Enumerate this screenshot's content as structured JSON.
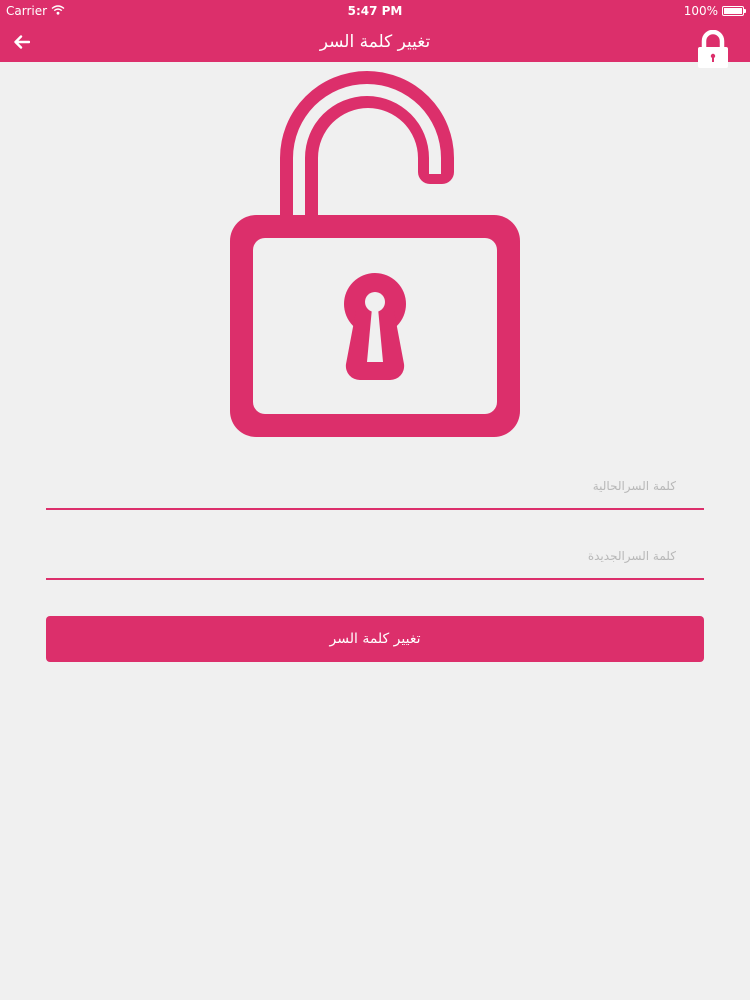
{
  "status_bar": {
    "carrier": "Carrier",
    "time": "5:47 PM",
    "battery": "100%",
    "battery_level": 1.0
  },
  "nav": {
    "title": "تغيير كلمة السر",
    "back_icon": "arrow-left-icon",
    "action_icon": "lock-icon"
  },
  "hero": {
    "icon": "unlocked-padlock-icon"
  },
  "form": {
    "current_password": {
      "placeholder": "كلمة السرالحالية",
      "value": ""
    },
    "new_password": {
      "placeholder": "كلمة السرالجديدة",
      "value": ""
    },
    "submit_label": "تغيير كلمة السر"
  },
  "colors": {
    "accent": "#dc2f6b",
    "background": "#f0f0f0",
    "on_accent": "#ffffff",
    "placeholder": "#b8b8b8"
  }
}
